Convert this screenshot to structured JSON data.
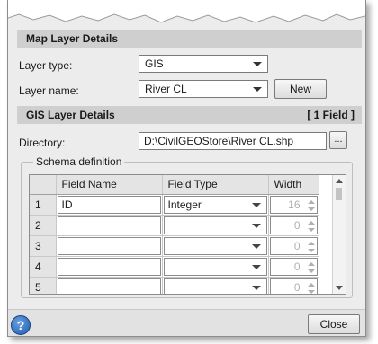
{
  "map_layer_details": {
    "header": "Map Layer Details",
    "layer_type_label": "Layer type:",
    "layer_type_value": "GIS",
    "layer_name_label": "Layer name:",
    "layer_name_value": "River CL",
    "new_button": "New"
  },
  "gis_layer_details": {
    "header": "GIS Layer Details",
    "field_count": "[ 1 Field ]",
    "directory_label": "Directory:",
    "directory_value": "D:\\CivilGEOStore\\River CL.shp",
    "browse_button": "..."
  },
  "schema": {
    "group_label": "Schema definition",
    "columns": [
      "",
      "Field Name",
      "Field Type",
      "Width"
    ],
    "rows": [
      {
        "num": "1",
        "name": "ID",
        "type": "Integer",
        "width": "16"
      },
      {
        "num": "2",
        "name": "",
        "type": "",
        "width": "0"
      },
      {
        "num": "3",
        "name": "",
        "type": "",
        "width": "0"
      },
      {
        "num": "4",
        "name": "",
        "type": "",
        "width": "0"
      },
      {
        "num": "5",
        "name": "",
        "type": "",
        "width": "0"
      }
    ]
  },
  "footer": {
    "help_icon": "?",
    "close_button": "Close"
  },
  "icons": {
    "dropdown": "chevron-down-icon",
    "help": "help-icon"
  }
}
